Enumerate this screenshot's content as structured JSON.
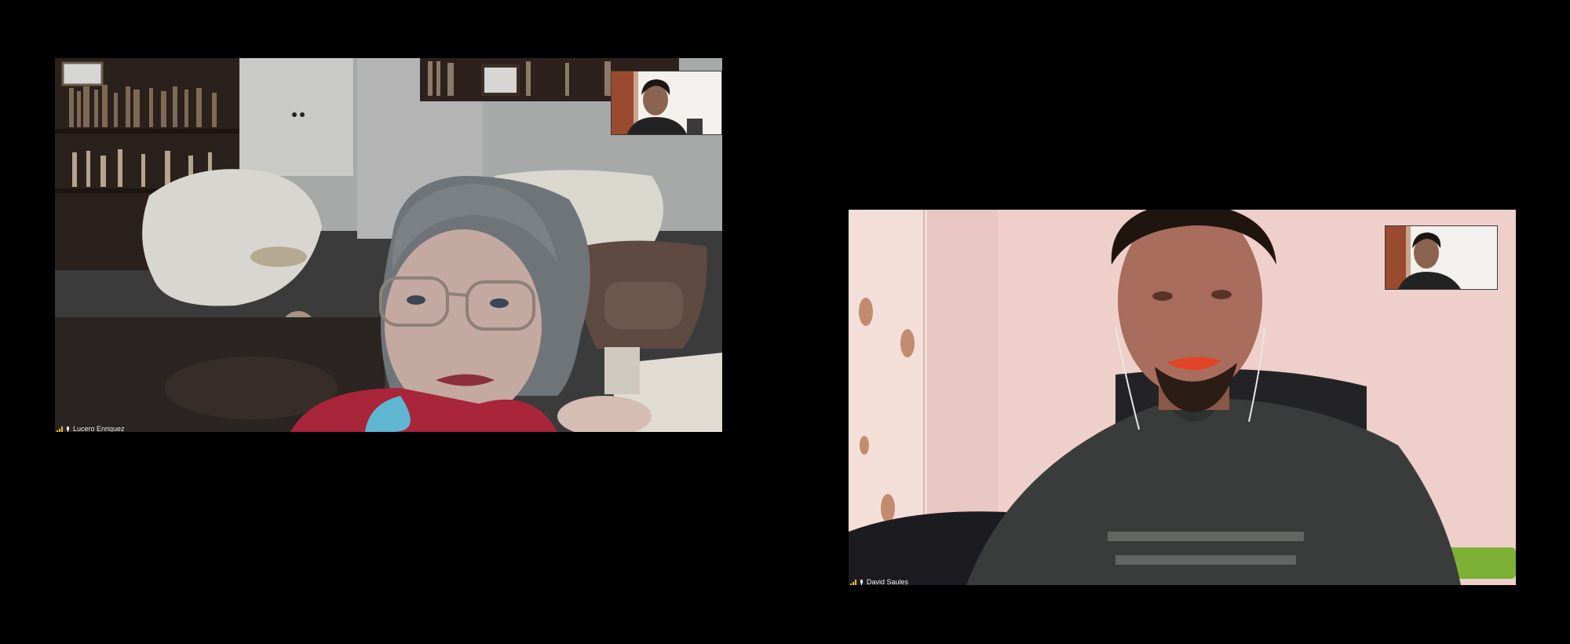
{
  "participants": [
    {
      "name": "Lucero Enriquez"
    },
    {
      "name": "David Saules"
    }
  ],
  "colors": {
    "background": "#000000",
    "signal": "#e8c21c",
    "name_text": "#ffffff"
  },
  "icons": [
    "signal-strength-icon",
    "microphone-icon"
  ]
}
